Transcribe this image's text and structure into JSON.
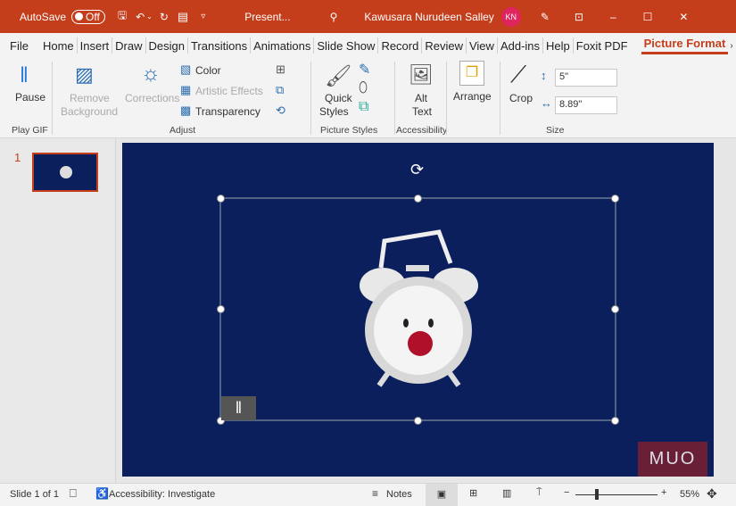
{
  "titlebar": {
    "autosave": "AutoSave",
    "autosave_state": "Off",
    "doc_title": "Present...",
    "user": "Kawusara Nurudeen Salley",
    "initials": "KN"
  },
  "tabs": [
    "File",
    "Home",
    "Insert",
    "Draw",
    "Design",
    "Transitions",
    "Animations",
    "Slide Show",
    "Record",
    "Review",
    "View",
    "Add-ins",
    "Help",
    "Foxit PDF"
  ],
  "active_tab": "Picture Format",
  "ribbon": {
    "pause": "Pause",
    "play_gif": "Play GIF",
    "remove_bg_1": "Remove",
    "remove_bg_2": "Background",
    "corrections": "Corrections",
    "color": "Color",
    "artistic": "Artistic Effects",
    "transparency": "Transparency",
    "adjust": "Adjust",
    "quick_1": "Quick",
    "quick_2": "Styles",
    "picture_styles": "Picture Styles",
    "alt_1": "Alt",
    "alt_2": "Text",
    "accessibility": "Accessibility",
    "arrange": "Arrange",
    "crop": "Crop",
    "height": "5\"",
    "width": "8.89\"",
    "size": "Size"
  },
  "thumb_number": "1",
  "watermark": "MUO",
  "status": {
    "slide": "Slide 1 of 1",
    "accessibility": "Accessibility: Investigate",
    "notes": "Notes",
    "zoom": "55%"
  },
  "colors": {
    "accent": "#c43e1c",
    "slide_bg": "#0b1f5c"
  }
}
